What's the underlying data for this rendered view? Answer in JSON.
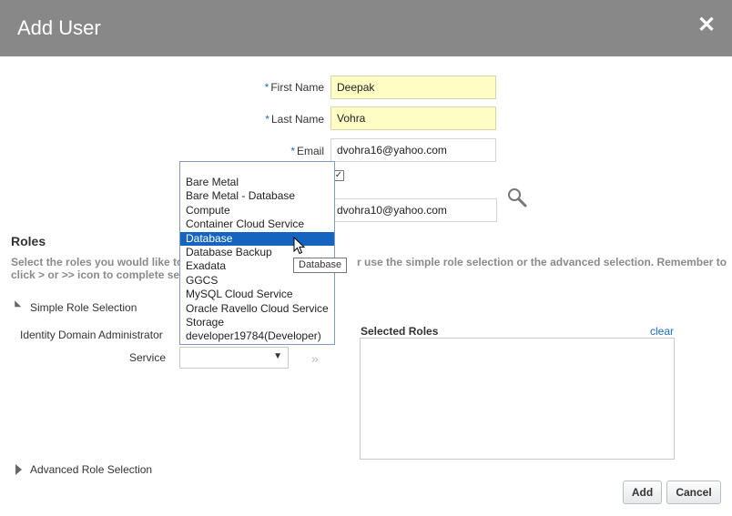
{
  "dialog": {
    "title": "Add User",
    "close_icon": "close-icon"
  },
  "form": {
    "required_marker": "*",
    "first_name": {
      "label": "First Name",
      "value": "Deepak"
    },
    "last_name": {
      "label": "Last Name",
      "value": "Vohra"
    },
    "email": {
      "label": "Email",
      "value": "dvohra16@yahoo.com"
    },
    "checkbox_checked": true,
    "manager_value": "dvohra10@yahoo.com"
  },
  "roles": {
    "title": "Roles",
    "description_left": "Select the roles you would like to",
    "description_right": "r use the simple role selection or the advanced selection. Remember to",
    "description_line2": "click > or >> icon to complete se",
    "simple_label": "Simple Role Selection",
    "identity_admin_label": "Identity Domain Administrator",
    "service_label": "Service",
    "service_selected": "",
    "move_all_glyph": "»",
    "selected_roles_label": "Selected Roles",
    "clear_label": "clear",
    "advanced_label": "Advanced Role Selection"
  },
  "service_dropdown": {
    "options": [
      "Bare Metal",
      "Bare Metal - Database",
      "Compute",
      "Container Cloud Service",
      "Database",
      "Database Backup",
      "Exadata",
      "GGCS",
      "MySQL Cloud Service",
      "Oracle Ravello Cloud Service",
      "Storage",
      "developer19784(Developer)"
    ],
    "highlighted": "Database",
    "tooltip": "Database"
  },
  "buttons": {
    "add": "Add",
    "cancel": "Cancel"
  },
  "colors": {
    "header_bg": "#888888",
    "required_input_bg": "#fdfdc4",
    "accent": "#1f6db5",
    "selection": "#1565c0"
  }
}
